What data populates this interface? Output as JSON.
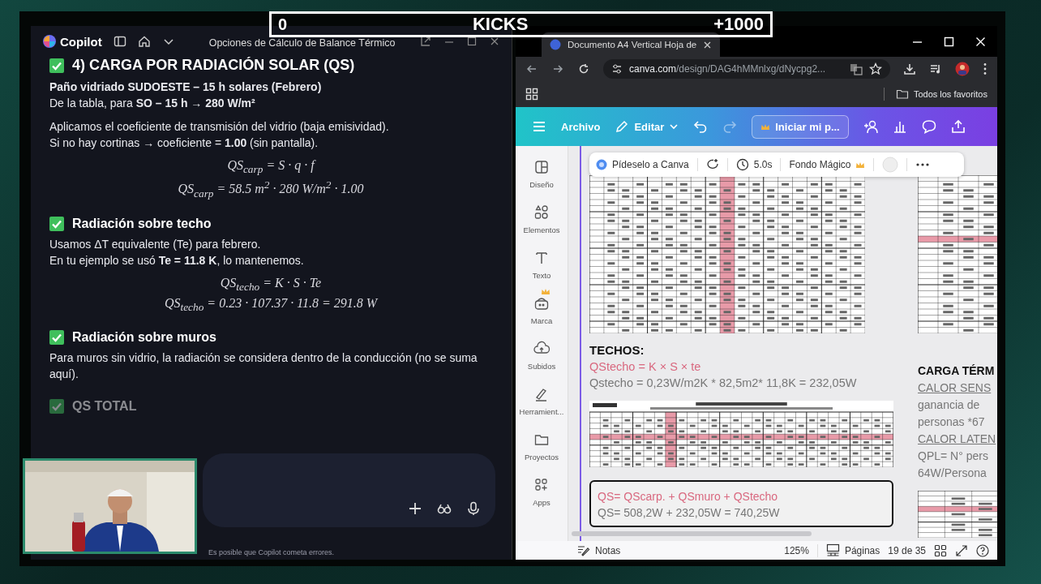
{
  "overlay": {
    "left_count": "0",
    "title": "KICKS",
    "right_count": "+1000"
  },
  "copilot": {
    "app_name": "Copilot",
    "title": "Opciones de Cálculo de Balance Térmico",
    "content": [
      {
        "kind": "heading",
        "text": "4) CARGA POR RADIACIÓN SOLAR (QS)",
        "faded": false
      },
      {
        "kind": "para",
        "lines": [
          {
            "text": "Paño vidriado SUDOESTE – 15 h solares (Febrero)",
            "bold": true
          },
          {
            "text": "De la tabla, para **SO – 15 h → 280 W/m²**",
            "bold": false
          }
        ]
      },
      {
        "kind": "para",
        "lines": [
          {
            "text": "Aplicamos el coeficiente de transmisión del vidrio (baja emisividad).",
            "bold": false
          },
          {
            "text": "Si no hay cortinas → coeficiente = **1.00** (sin pantalla).",
            "bold": false
          }
        ]
      },
      {
        "kind": "math",
        "lines": [
          "QS$_{carp}$ = S · q · f",
          "QS$_{carp}$ = 58.5 m$^{2}$ · 280 W/m$^{2}$ · 1.00"
        ]
      },
      {
        "kind": "subheading",
        "text": "Radiación sobre techo",
        "faded": false
      },
      {
        "kind": "para",
        "lines": [
          {
            "text": "Usamos ΔT equivalente (Te) para febrero.",
            "bold": false
          },
          {
            "text": "En tu ejemplo se usó **Te = 11.8 K**, lo mantenemos.",
            "bold": false
          }
        ]
      },
      {
        "kind": "math",
        "lines": [
          "QS$_{techo}$ = K · S · Te",
          "QS$_{techo}$ = 0.23 · 107.37 · 11.8 = 291.8 W"
        ]
      },
      {
        "kind": "subheading",
        "text": "Radiación sobre muros",
        "faded": false
      },
      {
        "kind": "para",
        "lines": [
          {
            "text": "Para muros sin vidrio, la radiación se considera dentro de la conducción (no se suma aquí).",
            "bold": false
          }
        ]
      },
      {
        "kind": "subheading",
        "text": "QS TOTAL",
        "faded": true
      }
    ],
    "footer": "Es posible que Copilot cometa errores."
  },
  "browser": {
    "tab": {
      "title": "Documento A4 Vertical Hoja de"
    },
    "url": {
      "domain": "canva.com",
      "path": "/design/DAG4hMMnlxg/dNycpg2..."
    },
    "bookmarks": "Todos los favoritos",
    "canva_toolbar": {
      "menu": "Archivo",
      "edit": "Editar",
      "upgrade": "Iniciar mi p..."
    },
    "sidebar": [
      "Diseño",
      "Elementos",
      "Texto",
      "Marca",
      "Subidos",
      "Herramient...",
      "Proyectos",
      "Apps"
    ],
    "floating_toolbar": {
      "ask": "Pídeselo a Canva",
      "duration": "5.0s",
      "magic": "Fondo Mágico"
    },
    "document": {
      "main": [
        {
          "kind": "table"
        },
        {
          "kind": "title",
          "text": "TECHOS:"
        },
        {
          "kind": "formula",
          "text": "QStecho = K × S × te"
        },
        {
          "kind": "calc",
          "text": "Qstecho = 0,23W/m2K * 82,5m2* 11,8K = 232,05W"
        },
        {
          "kind": "table"
        },
        {
          "kind": "box",
          "lines": [
            {
              "kind": "formula",
              "text": "QS= QScarp. + QSmuro + QStecho"
            },
            {
              "kind": "calc",
              "text": "QS= 508,2W + 232,05W = 740,25W"
            }
          ]
        }
      ],
      "side": [
        {
          "kind": "table"
        },
        {
          "kind": "title",
          "text": "CARGA TÉRM"
        },
        {
          "kind": "underlined",
          "text": "CALOR SENS"
        },
        {
          "kind": "calc",
          "text": "ganancia de"
        },
        {
          "kind": "calc",
          "text": "personas *67"
        },
        {
          "kind": "underlined",
          "text": "CALOR LATEN"
        },
        {
          "kind": "calc",
          "text": "QPL= N° pers"
        },
        {
          "kind": "calc",
          "text": "64W/Persona"
        },
        {
          "kind": "table"
        }
      ]
    },
    "status": {
      "notes": "Notas",
      "zoom": "125%",
      "pages": "Páginas",
      "page_count": "19 de 35"
    }
  }
}
